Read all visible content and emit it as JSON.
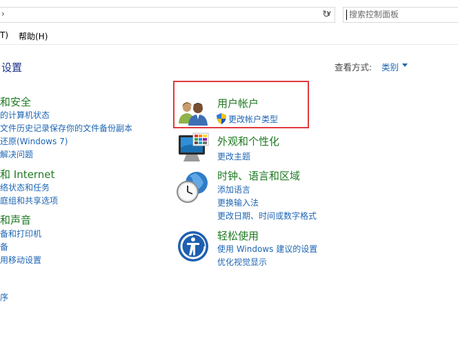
{
  "addressbar": {
    "chevron": "›",
    "dropdown": "∨",
    "refresh": "↻"
  },
  "search": {
    "placeholder": "搜索控制面板"
  },
  "menu": {
    "item_partial": "T)",
    "help": "帮助(H)"
  },
  "header": {
    "title": "设置",
    "view_label": "查看方式:",
    "view_value": "类别"
  },
  "left": {
    "security": {
      "title": "和安全",
      "links": [
        "的计算机状态",
        "文件历史记录保存你的文件备份副本",
        "还原(Windows 7)",
        "解决问题"
      ]
    },
    "network": {
      "title": "和 Internet",
      "links": [
        "络状态和任务",
        "庭组和共享选项"
      ]
    },
    "hardware": {
      "title": "和声音",
      "links": [
        "备和打印机",
        "备",
        "用移动设置"
      ]
    },
    "programs": {
      "link": "序"
    }
  },
  "right": {
    "accounts": {
      "title": "用户帐户",
      "link": "更改帐户类型",
      "icon": "users-icon"
    },
    "appearance": {
      "title": "外观和个性化",
      "link": "更改主题",
      "icon": "monitor-palette-icon"
    },
    "clock": {
      "title": "时钟、语言和区域",
      "links": [
        "添加语言",
        "更换输入法",
        "更改日期、时间或数字格式"
      ],
      "icon": "globe-clock-icon"
    },
    "ease": {
      "title": "轻松使用",
      "links": [
        "使用 Windows 建议的设置",
        "优化视觉显示"
      ],
      "icon": "ease-of-access-icon"
    }
  },
  "colors": {
    "accent_link": "#1e66b4",
    "category_green": "#1e7a22",
    "highlight_red": "#e0393e",
    "title_blue": "#1e3287"
  }
}
